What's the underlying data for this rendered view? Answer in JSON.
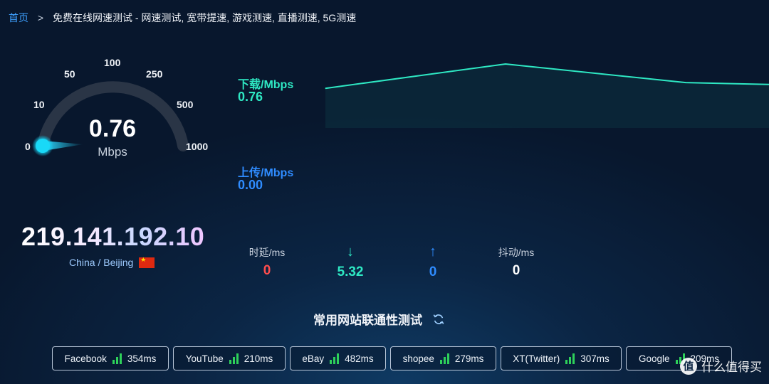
{
  "breadcrumb": {
    "home": "首页",
    "separator": ">",
    "title": "免费在线网速测试 - 网速测试, 宽带提速, 游戏测速, 直播测速, 5G测速"
  },
  "gauge": {
    "speed": "0.76",
    "unit": "Mbps",
    "ticks": [
      "0",
      "10",
      "50",
      "100",
      "250",
      "500",
      "1000"
    ],
    "needle_value_mbps": 0.76
  },
  "ip": {
    "address": "219.141.192.10",
    "location": "China / Beijing"
  },
  "download": {
    "label": "下载/Mbps",
    "value": "0.76",
    "color": "#2ee8c3"
  },
  "upload": {
    "label": "上传/Mbps",
    "value": "0.00",
    "color": "#2f8cff"
  },
  "chart_data": {
    "type": "line",
    "series": [
      {
        "name": "下载/Mbps",
        "values": [
          0.62,
          1.0,
          0.71,
          0.68
        ]
      }
    ]
  },
  "stats": {
    "latency": {
      "label": "时延/ms",
      "value": "0",
      "color": "#ff4d4d"
    },
    "download": {
      "icon": "↓",
      "value": "5.32",
      "color": "#2ee8c3"
    },
    "upload": {
      "icon": "↑",
      "value": "0",
      "color": "#2f8cff"
    },
    "jitter": {
      "label": "抖动/ms",
      "value": "0",
      "color": "#ffffff"
    }
  },
  "sites": {
    "title": "常用网站联通性测试",
    "items": [
      {
        "name": "Facebook",
        "time": "354ms"
      },
      {
        "name": "YouTube",
        "time": "210ms"
      },
      {
        "name": "eBay",
        "time": "482ms"
      },
      {
        "name": "shopee",
        "time": "279ms"
      },
      {
        "name": "XT(Twitter)",
        "time": "307ms"
      },
      {
        "name": "Google",
        "time": "209ms"
      }
    ]
  },
  "watermark": {
    "logo": "值",
    "text": "什么值得买"
  }
}
